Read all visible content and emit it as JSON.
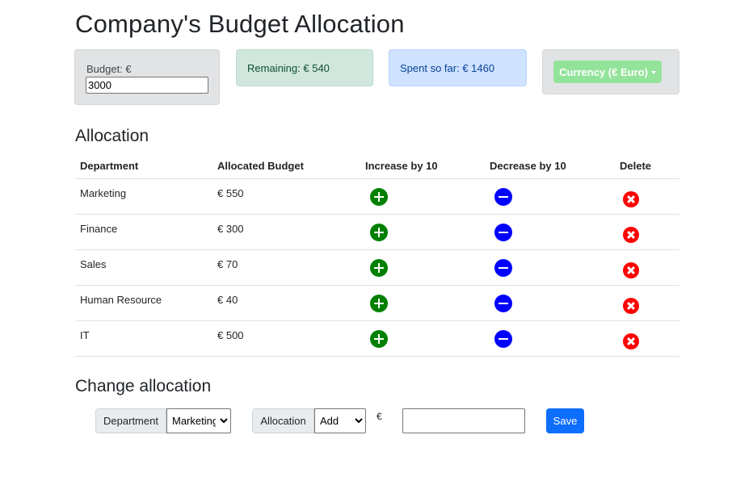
{
  "page": {
    "title": "Company's Budget Allocation"
  },
  "budget": {
    "label": "Budget: €",
    "value": "3000"
  },
  "remaining": {
    "text": "Remaining: € 540"
  },
  "spent": {
    "text": "Spent so far: € 1460"
  },
  "currency": {
    "label": "Currency (€ Euro)"
  },
  "allocation": {
    "title": "Allocation",
    "headers": [
      "Department",
      "Allocated Budget",
      "Increase by 10",
      "Decrease by 10",
      "Delete"
    ],
    "rows": [
      {
        "department": "Marketing",
        "budget": "€ 550"
      },
      {
        "department": "Finance",
        "budget": "€ 300"
      },
      {
        "department": "Sales",
        "budget": "€ 70"
      },
      {
        "department": "Human Resource",
        "budget": "€ 40"
      },
      {
        "department": "IT",
        "budget": "€ 500"
      }
    ]
  },
  "change": {
    "title": "Change allocation",
    "department_label": "Department",
    "department_selected": "Marketing",
    "allocation_label": "Allocation",
    "allocation_selected": "Add",
    "currency_symbol": "€",
    "amount_value": "",
    "save_label": "Save"
  },
  "colors": {
    "increase": "#008000",
    "decrease": "#0000ff",
    "delete": "#ff0000",
    "save": "#0d6efd",
    "currency_button": "#93e49a"
  },
  "icons": {
    "increase": "plus-circle-icon",
    "decrease": "minus-circle-icon",
    "delete": "x-circle-icon"
  }
}
